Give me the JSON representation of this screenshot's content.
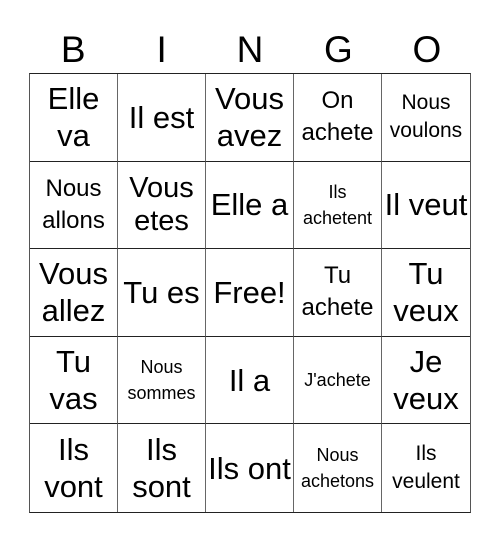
{
  "header": {
    "letters": [
      "B",
      "I",
      "N",
      "G",
      "O"
    ]
  },
  "board": {
    "rows": [
      [
        {
          "text": "Elle va",
          "size": "s-xl"
        },
        {
          "text": "Il est",
          "size": "s-xl"
        },
        {
          "text": "Vous avez",
          "size": "s-xl"
        },
        {
          "text": "On achete",
          "size": "s-md"
        },
        {
          "text": "Nous voulons",
          "size": "s-sm"
        }
      ],
      [
        {
          "text": "Nous allons",
          "size": "s-md"
        },
        {
          "text": "Vous etes",
          "size": "s-lg"
        },
        {
          "text": "Elle a",
          "size": "s-xl"
        },
        {
          "text": "Ils achetent",
          "size": "s-xs"
        },
        {
          "text": "Il veut",
          "size": "s-xl"
        }
      ],
      [
        {
          "text": "Vous allez",
          "size": "s-xl"
        },
        {
          "text": "Tu es",
          "size": "s-xl"
        },
        {
          "text": "Free!",
          "size": "s-xl"
        },
        {
          "text": "Tu achete",
          "size": "s-md"
        },
        {
          "text": "Tu veux",
          "size": "s-xl"
        }
      ],
      [
        {
          "text": "Tu vas",
          "size": "s-xl"
        },
        {
          "text": "Nous sommes",
          "size": "s-xs"
        },
        {
          "text": "Il a",
          "size": "s-xl"
        },
        {
          "text": "J'achete",
          "size": "s-xs"
        },
        {
          "text": "Je veux",
          "size": "s-xl"
        }
      ],
      [
        {
          "text": "Ils vont",
          "size": "s-xl"
        },
        {
          "text": "Ils sont",
          "size": "s-xl"
        },
        {
          "text": "Ils ont",
          "size": "s-xl"
        },
        {
          "text": "Nous achetons",
          "size": "s-xs"
        },
        {
          "text": "Ils veulent",
          "size": "s-sm"
        }
      ]
    ]
  }
}
